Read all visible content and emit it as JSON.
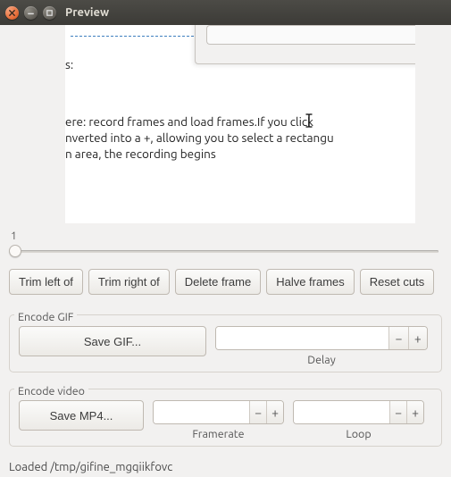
{
  "window": {
    "title": "Preview"
  },
  "preview": {
    "line1": "s:",
    "line2_a": "ere: record frames and load frames.",
    "line2_b": "If you click ",
    "line3": "nverted into a +, allowing you to select a rectangu",
    "line4": "n area, the recording begins"
  },
  "slider": {
    "value": "1"
  },
  "buttons": {
    "trim_left": "Trim left of",
    "trim_right": "Trim right of",
    "delete_frame": "Delete frame",
    "halve_frames": "Halve frames",
    "reset_cuts": "Reset cuts"
  },
  "gif": {
    "title": "Encode GIF",
    "save": "Save GIF...",
    "delay_label": "Delay",
    "delay_value": ""
  },
  "video": {
    "title": "Encode video",
    "save": "Save MP4...",
    "framerate_label": "Framerate",
    "framerate_value": "",
    "loop_label": "Loop",
    "loop_value": ""
  },
  "status": "Loaded /tmp/gifine_mgqiikfovc",
  "glyph": {
    "minus": "−",
    "plus": "+"
  }
}
